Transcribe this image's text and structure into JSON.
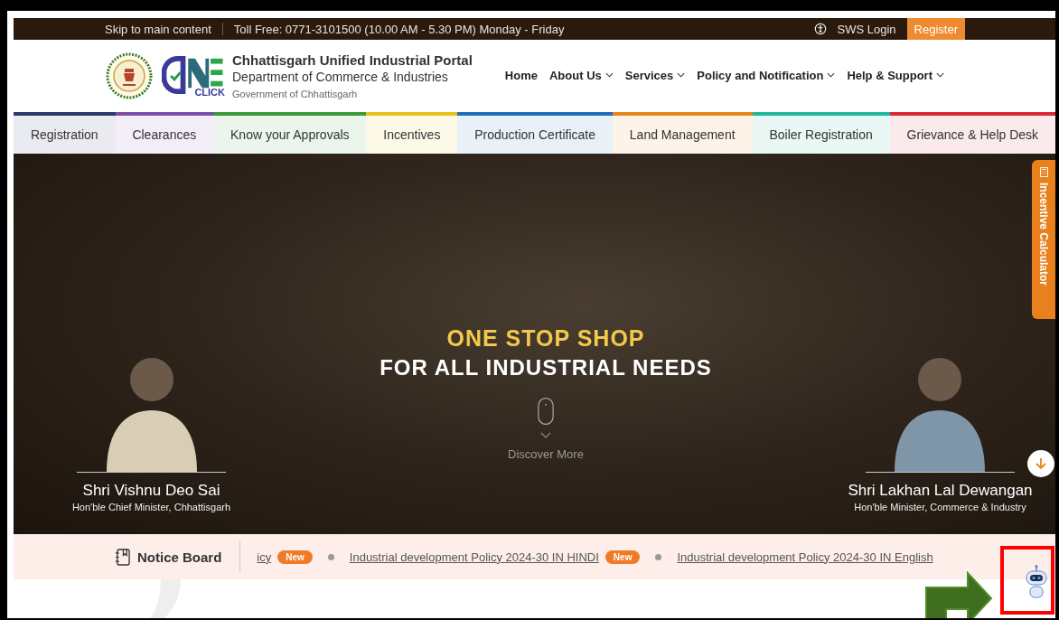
{
  "top_bar": {
    "skip_link": "Skip to main content",
    "toll_free": "Toll Free: 0771-3101500 (10.00 AM - 5.30 PM) Monday - Friday",
    "login": "SWS Login",
    "register": "Register"
  },
  "header": {
    "title": "Chhattisgarh Unified Industrial Portal",
    "subtitle": "Department of Commerce & Industries",
    "government": "Government of Chhattisgarh",
    "logo_text": "CLICK",
    "nav": [
      {
        "label": "Home",
        "dropdown": false
      },
      {
        "label": "About Us",
        "dropdown": true
      },
      {
        "label": "Services",
        "dropdown": true
      },
      {
        "label": "Policy and Notification",
        "dropdown": true
      },
      {
        "label": "Help & Support",
        "dropdown": true
      }
    ]
  },
  "categories": [
    {
      "label": "Registration",
      "color": "#2b3a6b"
    },
    {
      "label": "Clearances",
      "color": "#7b4fa8"
    },
    {
      "label": "Know your Approvals",
      "color": "#3a9a3a"
    },
    {
      "label": "Incentives",
      "color": "#e8c21a"
    },
    {
      "label": "Production Certificate",
      "color": "#1e6fb8"
    },
    {
      "label": "Land Management",
      "color": "#e8841a"
    },
    {
      "label": "Boiler Registration",
      "color": "#21b89a"
    },
    {
      "label": "Grievance & Help Desk",
      "color": "#d92a35"
    }
  ],
  "hero": {
    "headline": "ONE STOP SHOP",
    "subheadline": "FOR ALL INDUSTRIAL NEEDS",
    "discover": "Discover More",
    "ministers": [
      {
        "name": "Shri Vishnu Deo Sai",
        "role": "Hon'ble Chief Minister, Chhattisgarh"
      },
      {
        "name": "Shri Lakhan Lal Dewangan",
        "role": "Hon'ble Minister, Commerce & Industry"
      }
    ]
  },
  "side_tab": {
    "label": "Incentive Calculator"
  },
  "notice_board": {
    "title": "Notice Board",
    "items": [
      {
        "text": "icy",
        "badge": "New"
      },
      {
        "text": "Industrial development Policy 2024-30 IN HINDI",
        "badge": "New"
      },
      {
        "text": "Industrial development Policy 2024-30 IN English"
      }
    ]
  }
}
